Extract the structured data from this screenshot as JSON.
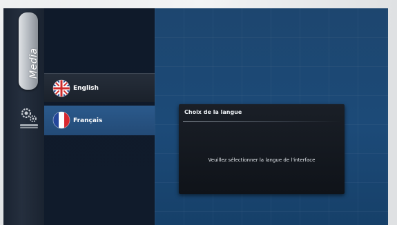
{
  "sidebar": {
    "media_label": "Media",
    "icons": [
      "media-tab",
      "settings-icon"
    ]
  },
  "language_menu": {
    "items": [
      {
        "label": "English",
        "flag": "uk-flag-icon",
        "selected": false
      },
      {
        "label": "Français",
        "flag": "france-flag-icon",
        "selected": true
      }
    ]
  },
  "dialog": {
    "title": "Choix de la langue",
    "message": "Veuillez sélectionner la langue de l'interface"
  },
  "colors": {
    "screen_bg": "#1c4a78",
    "menu_bg": "#0f1a2a",
    "selected_item": "#2b5a8c",
    "dialog_bg": "#12161d"
  }
}
